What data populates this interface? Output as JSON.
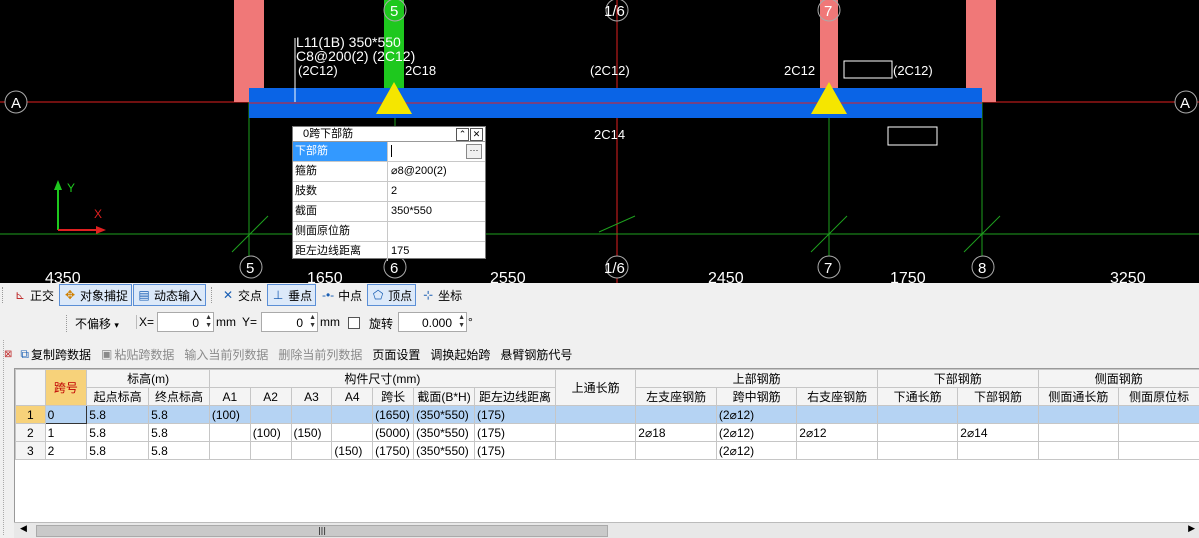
{
  "canvas": {
    "annot_line1": "L11(1B) 350*550",
    "annot_line2": "C8@200(2) (2C12)",
    "annot_left": "(2C12)",
    "annot_2c18": "2C18",
    "annot_mid": "(2C12)",
    "annot_2c12": "2C12",
    "annot_right": "(2C12)",
    "annot_2c14": "2C14",
    "axis_a": "A",
    "axes_top": [
      "5",
      "1/6",
      "7"
    ],
    "axes_bottom": [
      "5",
      "6",
      "1/6",
      "7",
      "8"
    ],
    "dims": [
      "4350",
      "1650",
      "2550",
      "2450",
      "1750",
      "3250"
    ],
    "ucs_x": "X",
    "ucs_y": "Y"
  },
  "popup": {
    "title": "0跨下部筋",
    "rows": [
      {
        "key": "下部筋",
        "value": ""
      },
      {
        "key": "箍筋",
        "value": "⌀8@200(2)"
      },
      {
        "key": "肢数",
        "value": "2"
      },
      {
        "key": "截面",
        "value": "350*550"
      },
      {
        "key": "侧面原位筋",
        "value": ""
      },
      {
        "key": "距左边线距离",
        "value": "175"
      }
    ]
  },
  "toolbar1": {
    "ortho": "正交",
    "snap": "对象捕捉",
    "dyn": "动态输入",
    "inter": "交点",
    "perp": "垂点",
    "mid": "中点",
    "vertex": "顶点",
    "coord": "坐标"
  },
  "toolbar2": {
    "offset": "不偏移",
    "x_label": "X=",
    "x_value": "0",
    "mm1": "mm",
    "y_label": "Y=",
    "y_value": "0",
    "mm2": "mm",
    "rotate": "旋转",
    "rot_value": "0.000",
    "deg": "°"
  },
  "toolbar3": {
    "copy": "复制跨数据",
    "paste": "粘贴跨数据",
    "input_col": "输入当前列数据",
    "del_col": "删除当前列数据",
    "page": "页面设置",
    "swap": "调换起始跨",
    "cant": "悬臂钢筋代号"
  },
  "table": {
    "h_span": "跨号",
    "h_elev": "标高(m)",
    "h_size": "构件尺寸(mm)",
    "h_top_long": "上通长筋",
    "h_top": "上部钢筋",
    "h_bot": "下部钢筋",
    "h_side": "侧面钢筋",
    "sub": [
      "起点标高",
      "终点标高",
      "A1",
      "A2",
      "A3",
      "A4",
      "跨长",
      "截面(B*H)",
      "距左边线距离",
      "左支座钢筋",
      "跨中钢筋",
      "右支座钢筋",
      "下通长筋",
      "下部钢筋",
      "侧面通长筋",
      "侧面原位标"
    ],
    "rows": [
      [
        "1",
        "0",
        "5.8",
        "5.8",
        "(100)",
        "",
        "",
        "",
        "(1650)",
        "(350*550)",
        "(175)",
        "",
        "",
        "(2⌀12)",
        "",
        "",
        "",
        "",
        "",
        ""
      ],
      [
        "2",
        "1",
        "5.8",
        "5.8",
        "",
        "(100)",
        "(150)",
        "",
        "(5000)",
        "(350*550)",
        "(175)",
        "",
        "2⌀18",
        "(2⌀12)",
        "2⌀12",
        "",
        "2⌀14",
        "",
        "",
        ""
      ],
      [
        "3",
        "2",
        "5.8",
        "5.8",
        "",
        "",
        "",
        "(150)",
        "(1750)",
        "(350*550)",
        "(175)",
        "",
        "",
        "(2⌀12)",
        "",
        "",
        "",
        "",
        "",
        ""
      ]
    ]
  },
  "colors": {
    "beam": "#0a64e6",
    "column": "#f07878",
    "support": "#f5e600",
    "green_col": "#1ec81e"
  }
}
